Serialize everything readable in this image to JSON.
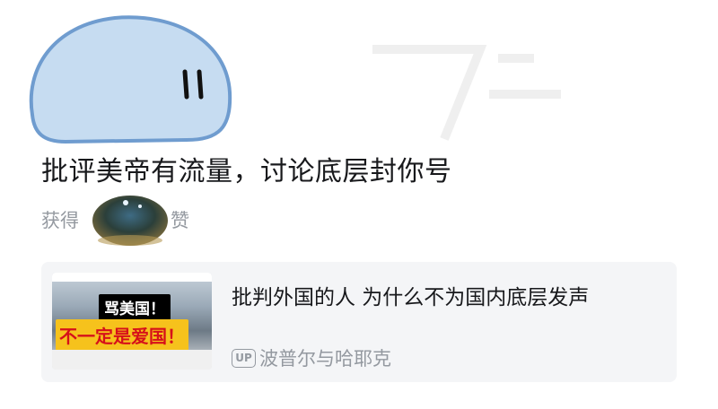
{
  "post": {
    "headline": "批评美帝有流量，讨论底层封你号",
    "likes_prefix": "获得",
    "likes_suffix": "赞"
  },
  "video_card": {
    "thumbnail": {
      "line1": "骂美国！",
      "line2": "不一定是爱国！"
    },
    "title": "批判外国的人 为什么不为国内底层发声",
    "up_badge": "UP",
    "uploader": "波普尔与哈耶克"
  },
  "icons": {
    "avatar": "blue-blob-avatar-icon",
    "orb": "glass-orb-sticker-icon"
  },
  "colors": {
    "avatar_fill": "#c6dcf1",
    "avatar_stroke": "#6f9ccf",
    "text_primary": "#18191c",
    "text_secondary": "#9499a0",
    "card_bg": "#f4f5f7",
    "thumb_yellow": "#f6c21c",
    "thumb_red": "#d6101a"
  }
}
